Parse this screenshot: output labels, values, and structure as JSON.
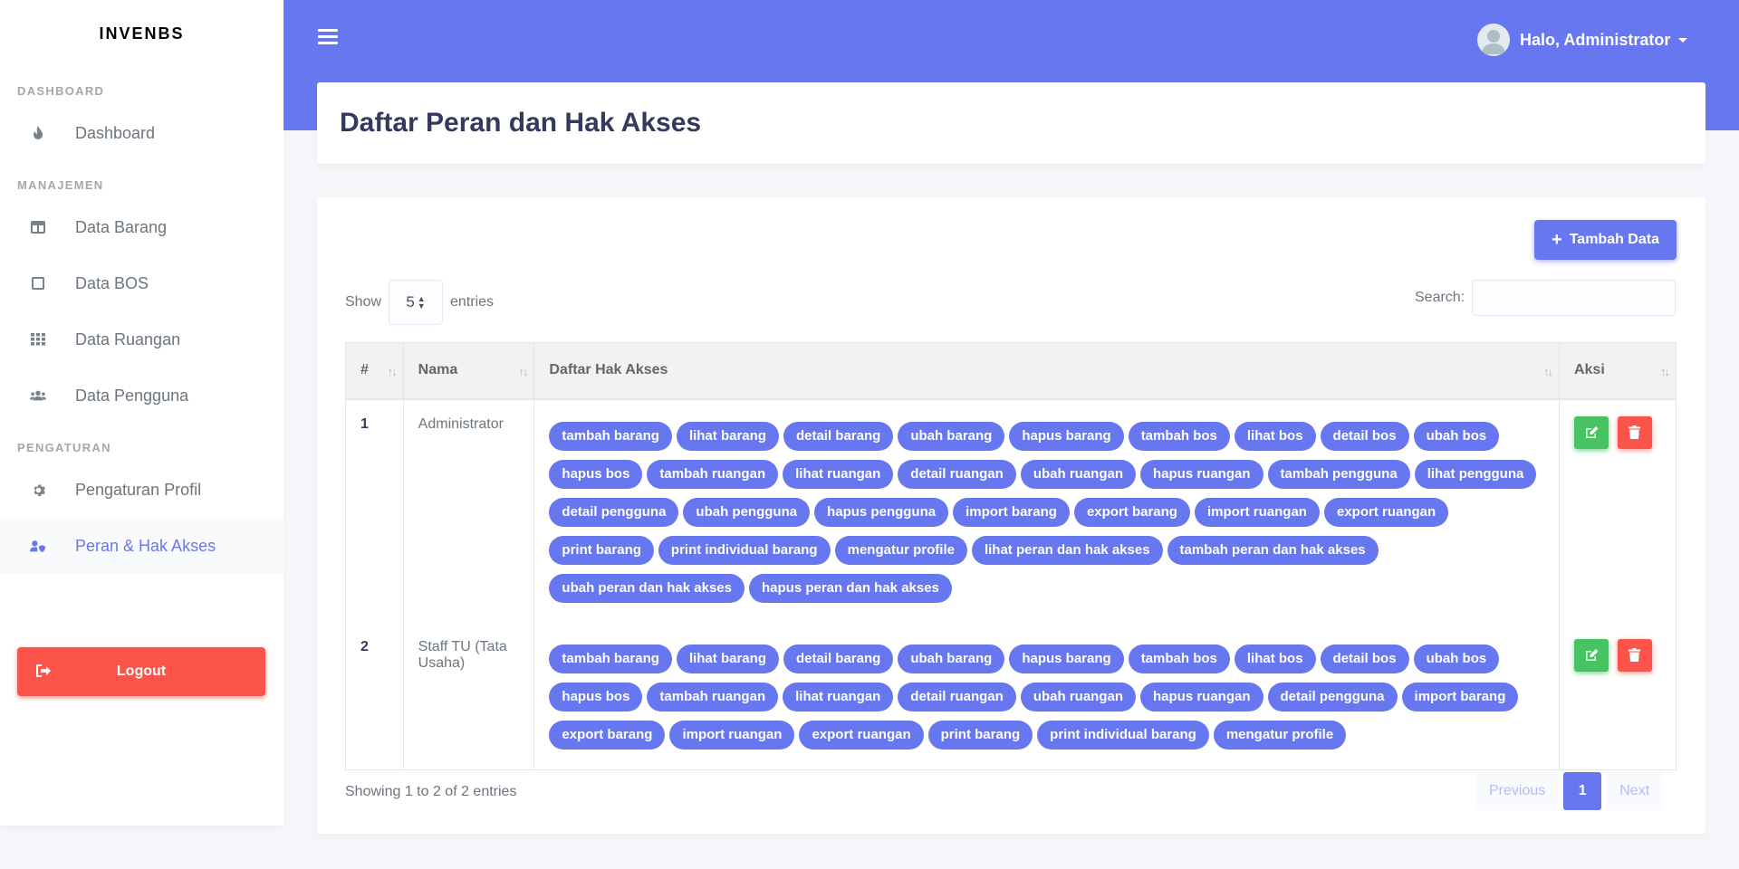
{
  "sidebar": {
    "brand": "INVENBS",
    "sections": [
      {
        "header": "DASHBOARD",
        "items": [
          {
            "label": "Dashboard",
            "icon": "fire-icon"
          }
        ]
      },
      {
        "header": "MANAJEMEN",
        "items": [
          {
            "label": "Data Barang",
            "icon": "columns-icon"
          },
          {
            "label": "Data BOS",
            "icon": "square-icon"
          },
          {
            "label": "Data Ruangan",
            "icon": "grid-icon"
          },
          {
            "label": "Data Pengguna",
            "icon": "users-icon"
          }
        ]
      },
      {
        "header": "PENGATURAN",
        "items": [
          {
            "label": "Pengaturan Profil",
            "icon": "gear-icon"
          },
          {
            "label": "Peran & Hak Akses",
            "icon": "user-shield-icon",
            "active": true
          }
        ]
      }
    ],
    "logout_label": "Logout"
  },
  "navbar": {
    "user_greeting": "Halo, Administrator"
  },
  "page": {
    "title": "Daftar Peran dan Hak Akses"
  },
  "card": {
    "add_button_label": "Tambah Data",
    "show_label": "Show",
    "entries_value": "5",
    "entries_label": "entries",
    "search_label": "Search:",
    "table": {
      "headers": [
        "#",
        "Nama",
        "Daftar Hak Akses",
        "Aksi"
      ],
      "rows": [
        {
          "num": "1",
          "name": "Administrator",
          "permissions": [
            "tambah barang",
            "lihat barang",
            "detail barang",
            "ubah barang",
            "hapus barang",
            "tambah bos",
            "lihat bos",
            "detail bos",
            "ubah bos",
            "hapus bos",
            "tambah ruangan",
            "lihat ruangan",
            "detail ruangan",
            "ubah ruangan",
            "hapus ruangan",
            "tambah pengguna",
            "lihat pengguna",
            "detail pengguna",
            "ubah pengguna",
            "hapus pengguna",
            "import barang",
            "export barang",
            "import ruangan",
            "export ruangan",
            "print barang",
            "print individual barang",
            "mengatur profile",
            "lihat peran dan hak akses",
            "tambah peran dan hak akses",
            "ubah peran dan hak akses",
            "hapus peran dan hak akses"
          ]
        },
        {
          "num": "2",
          "name": "Staff TU (Tata Usaha)",
          "permissions": [
            "tambah barang",
            "lihat barang",
            "detail barang",
            "ubah barang",
            "hapus barang",
            "tambah bos",
            "lihat bos",
            "detail bos",
            "ubah bos",
            "hapus bos",
            "tambah ruangan",
            "lihat ruangan",
            "detail ruangan",
            "ubah ruangan",
            "hapus ruangan",
            "detail pengguna",
            "import barang",
            "export barang",
            "import ruangan",
            "export ruangan",
            "print barang",
            "print individual barang",
            "mengatur profile"
          ]
        }
      ]
    },
    "info_text": "Showing 1 to 2 of 2 entries",
    "pagination": {
      "previous": "Previous",
      "current": "1",
      "next": "Next"
    }
  },
  "colors": {
    "primary": "#6777ef",
    "success": "#47c363",
    "danger": "#fc544b"
  }
}
